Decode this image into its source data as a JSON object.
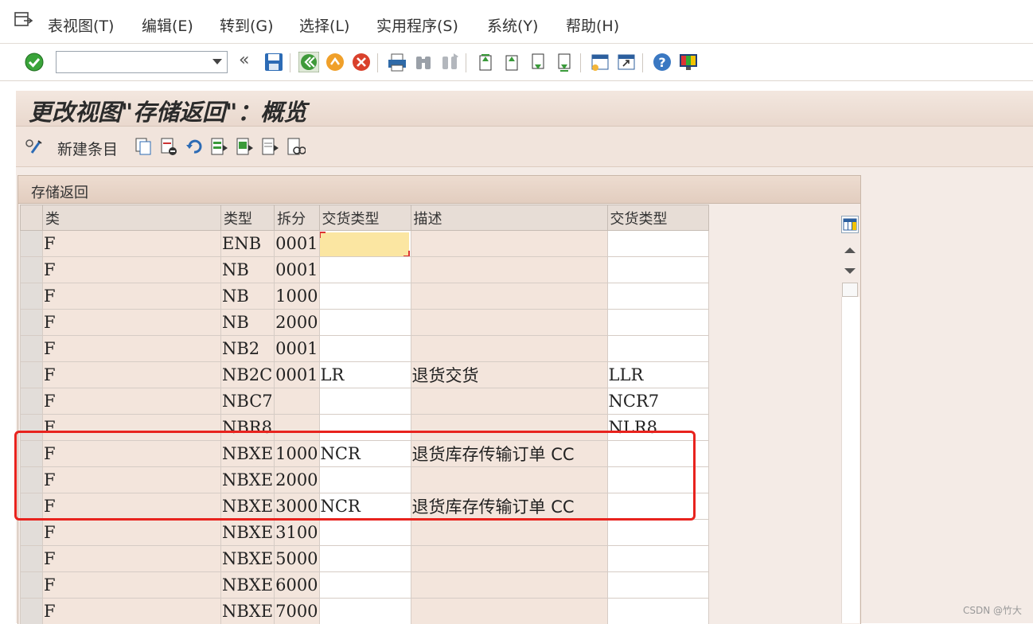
{
  "menu": {
    "items": [
      "表视图(T)",
      "编辑(E)",
      "转到(G)",
      "选择(L)",
      "实用程序(S)",
      "系统(Y)",
      "帮助(H)"
    ]
  },
  "toolbar": {
    "command_field_value": "",
    "icons": [
      "enter-check-icon",
      "history-back-icon",
      "save-icon",
      "back-icon",
      "exit-icon",
      "cancel-icon",
      "print-icon",
      "find-icon",
      "find-next-icon",
      "first-page-icon",
      "previous-page-icon",
      "next-page-icon",
      "last-page-icon",
      "create-session-icon",
      "shortcut-icon",
      "help-icon",
      "layout-icon"
    ]
  },
  "title": "更改视图\"存储返回\"：概览",
  "app_toolbar": {
    "new_entries_label": "新建条目"
  },
  "table": {
    "caption": "存储返回",
    "columns": [
      "类",
      "类型",
      "拆分",
      "交货类型",
      "描述",
      "交货类型"
    ],
    "rows": [
      {
        "cls": "F",
        "type": "ENB",
        "split": "0001",
        "dlv": "",
        "desc": "",
        "dlv2": ""
      },
      {
        "cls": "F",
        "type": "NB",
        "split": "0001",
        "dlv": "",
        "desc": "",
        "dlv2": ""
      },
      {
        "cls": "F",
        "type": "NB",
        "split": "1000",
        "dlv": "",
        "desc": "",
        "dlv2": ""
      },
      {
        "cls": "F",
        "type": "NB",
        "split": "2000",
        "dlv": "",
        "desc": "",
        "dlv2": ""
      },
      {
        "cls": "F",
        "type": "NB2",
        "split": "0001",
        "dlv": "",
        "desc": "",
        "dlv2": ""
      },
      {
        "cls": "F",
        "type": "NB2C",
        "split": "0001",
        "dlv": "LR",
        "desc": "退货交货",
        "dlv2": "LLR"
      },
      {
        "cls": "F",
        "type": "NBC7",
        "split": "",
        "dlv": "",
        "desc": "",
        "dlv2": "NCR7"
      },
      {
        "cls": "F",
        "type": "NBR8",
        "split": "",
        "dlv": "",
        "desc": "",
        "dlv2": "NLR8"
      },
      {
        "cls": "F",
        "type": "NBXE",
        "split": "1000",
        "dlv": "NCR",
        "desc": "退货库存传输订单 CC",
        "dlv2": ""
      },
      {
        "cls": "F",
        "type": "NBXE",
        "split": "2000",
        "dlv": "",
        "desc": "",
        "dlv2": ""
      },
      {
        "cls": "F",
        "type": "NBXE",
        "split": "3000",
        "dlv": "NCR",
        "desc": "退货库存传输订单 CC",
        "dlv2": ""
      },
      {
        "cls": "F",
        "type": "NBXE",
        "split": "3100",
        "dlv": "",
        "desc": "",
        "dlv2": ""
      },
      {
        "cls": "F",
        "type": "NBXE",
        "split": "5000",
        "dlv": "",
        "desc": "",
        "dlv2": ""
      },
      {
        "cls": "F",
        "type": "NBXE",
        "split": "6000",
        "dlv": "",
        "desc": "",
        "dlv2": ""
      },
      {
        "cls": "F",
        "type": "NBXE",
        "split": "7000",
        "dlv": "",
        "desc": "",
        "dlv2": ""
      }
    ]
  },
  "watermark": "CSDN @竹大",
  "colors": {
    "highlight": "#e8231e",
    "focus_field": "#fbe6a2",
    "title_bg": "#f3e7df"
  }
}
